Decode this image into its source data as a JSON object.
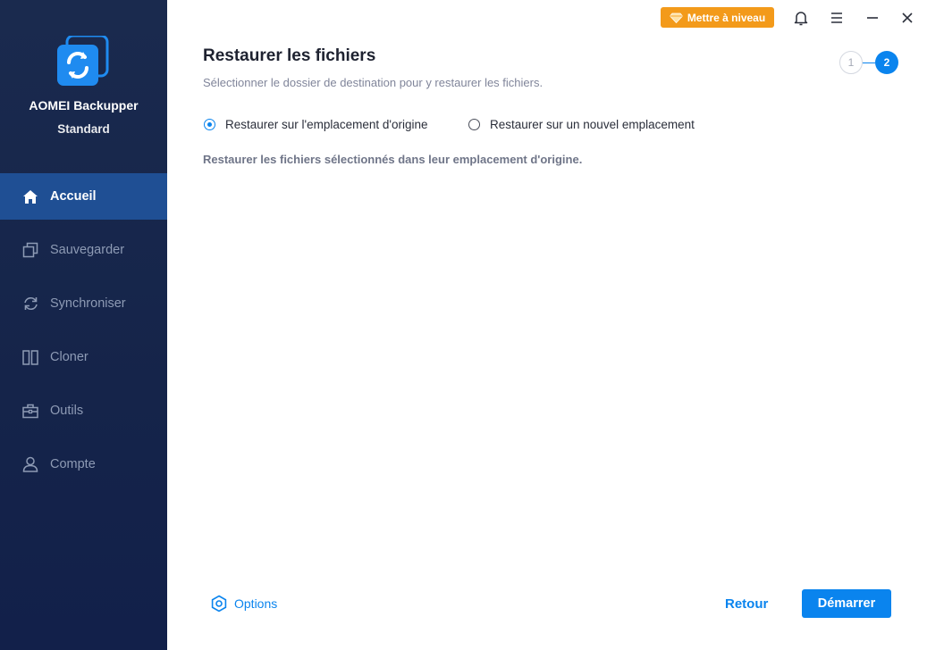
{
  "app": {
    "name": "AOMEI Backupper",
    "edition": "Standard"
  },
  "sidebar": {
    "items": [
      {
        "label": "Accueil",
        "icon": "home-icon",
        "active": true
      },
      {
        "label": "Sauvegarder",
        "icon": "backup-icon",
        "active": false
      },
      {
        "label": "Synchroniser",
        "icon": "sync-icon",
        "active": false
      },
      {
        "label": "Cloner",
        "icon": "clone-icon",
        "active": false
      },
      {
        "label": "Outils",
        "icon": "toolbox-icon",
        "active": false
      },
      {
        "label": "Compte",
        "icon": "user-icon",
        "active": false
      }
    ]
  },
  "topbar": {
    "upgrade_label": "Mettre à niveau",
    "icons": [
      "bell-icon",
      "menu-icon",
      "minimize-icon",
      "close-icon"
    ]
  },
  "main": {
    "title": "Restaurer les fichiers",
    "subtitle": "Sélectionner le dossier de destination pour y restaurer les fichiers.",
    "steps": [
      "1",
      "2"
    ],
    "current_step": "2",
    "options": [
      {
        "label": "Restaurer sur l'emplacement d'origine",
        "selected": true
      },
      {
        "label": "Restaurer sur un nouvel emplacement",
        "selected": false
      }
    ],
    "description": "Restaurer les fichiers sélectionnés dans leur emplacement d'origine."
  },
  "footer": {
    "options_label": "Options",
    "back_label": "Retour",
    "start_label": "Démarrer"
  },
  "colors": {
    "accent": "#0a84ee",
    "sidebar_bg": "#15244a",
    "sidebar_active": "#1f4f94",
    "upgrade": "#f39a1a"
  }
}
